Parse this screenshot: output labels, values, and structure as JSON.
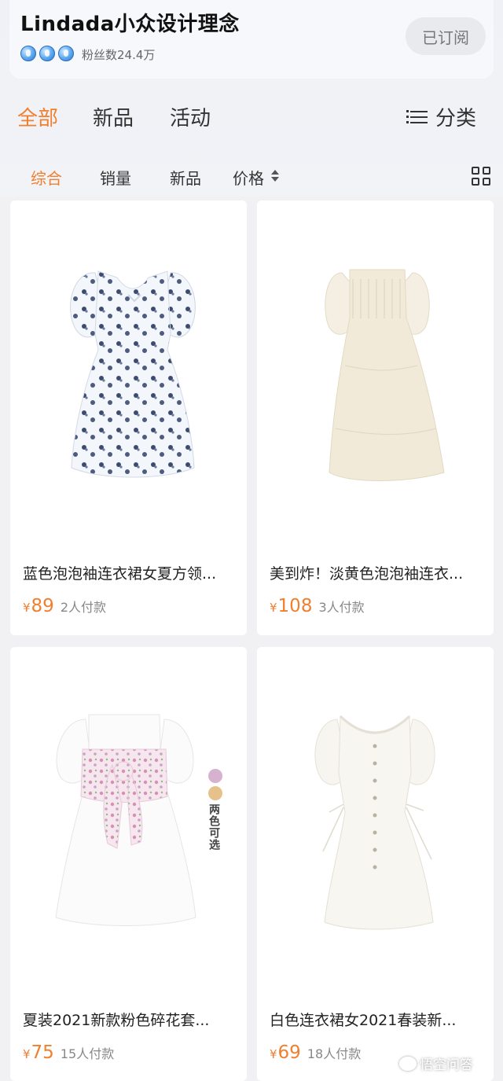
{
  "store": {
    "name": "Lindada小众设计理念",
    "badge_icons": [
      "hot-air-balloon-icon",
      "hot-air-balloon-icon",
      "hot-air-balloon-icon"
    ],
    "fans": "粉丝数24.4万",
    "subscribe_label": "已订阅"
  },
  "main_tabs": [
    {
      "label": "全部",
      "active": true
    },
    {
      "label": "新品",
      "active": false
    },
    {
      "label": "活动",
      "active": false
    }
  ],
  "category": {
    "label": "分类",
    "icon": "menu-icon"
  },
  "sort_tabs": [
    {
      "label": "综合",
      "active": true
    },
    {
      "label": "销量",
      "active": false
    },
    {
      "label": "新品",
      "active": false
    },
    {
      "label": "价格",
      "active": false,
      "icon": "sort-arrows-icon"
    }
  ],
  "view_toggle_icon": "grid-view-icon",
  "products": [
    {
      "title": "蓝色泡泡袖连衣裙女夏方领...",
      "currency": "¥",
      "price": "89",
      "sold": "2人付款"
    },
    {
      "title": "美到炸！淡黄色泡泡袖连衣...",
      "currency": "¥",
      "price": "108",
      "sold": "3人付款"
    },
    {
      "title": "夏装2021新款粉色碎花套...",
      "currency": "¥",
      "price": "75",
      "sold": "15人付款",
      "tag": "两色可选"
    },
    {
      "title": "白色连衣裙女2021春装新...",
      "currency": "¥",
      "price": "69",
      "sold": "18人付款"
    }
  ],
  "colors": {
    "accent": "#f07f2f",
    "page_bg": "#f1f1f3",
    "swatch_pink": "#d7b2cf",
    "swatch_tan": "#e6c28a"
  },
  "watermark": "悟空问答"
}
